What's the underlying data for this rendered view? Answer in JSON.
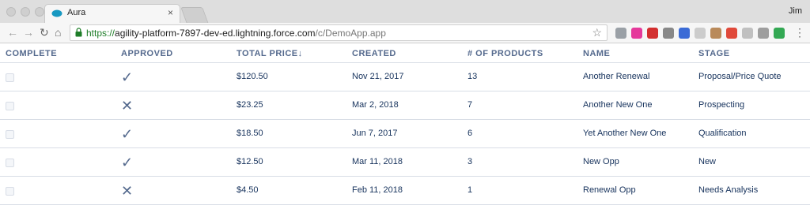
{
  "browser": {
    "tab_title": "Aura",
    "tab_close": "×",
    "user_name": "Jim",
    "url_protocol": "https://",
    "url_host": "agility-platform-7897-dev-ed.lightning.force.com",
    "url_path": "/c/DemoApp.app",
    "extensions": [
      {
        "name": "info-icon",
        "color": "#9aa0a6"
      },
      {
        "name": "color-wheel-icon",
        "color": "#e5399b"
      },
      {
        "name": "adblock-icon",
        "color": "#d32f2f"
      },
      {
        "name": "person-icon",
        "color": "#888888"
      },
      {
        "name": "blue-square-icon",
        "color": "#3b6bd6"
      },
      {
        "name": "square-icon",
        "color": "#cccccc"
      },
      {
        "name": "flag-icon",
        "color": "#b98a5a"
      },
      {
        "name": "n-icon",
        "color": "#e0493a"
      },
      {
        "name": "cloud-icon",
        "color": "#c0c0c0"
      },
      {
        "name": "list-icon",
        "color": "#9e9e9e"
      },
      {
        "name": "grammarly-icon",
        "color": "#33a853"
      }
    ]
  },
  "table": {
    "headers": {
      "complete": "COMPLETE",
      "approved": "APPROVED",
      "total_price": "TOTAL PRICE",
      "sort_arrow": "↓",
      "created": "CREATED",
      "products": "# OF PRODUCTS",
      "name": "NAME",
      "stage": "STAGE"
    },
    "rows": [
      {
        "approved": "✓",
        "total_price": "$120.50",
        "created": "Nov 21, 2017",
        "products": "13",
        "name": "Another Renewal",
        "stage": "Proposal/Price Quote"
      },
      {
        "approved": "✕",
        "total_price": "$23.25",
        "created": "Mar 2, 2018",
        "products": "7",
        "name": "Another New One",
        "stage": "Prospecting"
      },
      {
        "approved": "✓",
        "total_price": "$18.50",
        "created": "Jun 7, 2017",
        "products": "6",
        "name": "Yet Another New One",
        "stage": "Qualification"
      },
      {
        "approved": "✓",
        "total_price": "$12.50",
        "created": "Mar 11, 2018",
        "products": "3",
        "name": "New Opp",
        "stage": "New"
      },
      {
        "approved": "✕",
        "total_price": "$4.50",
        "created": "Feb 11, 2018",
        "products": "1",
        "name": "Renewal Opp",
        "stage": "Needs Analysis"
      }
    ]
  }
}
